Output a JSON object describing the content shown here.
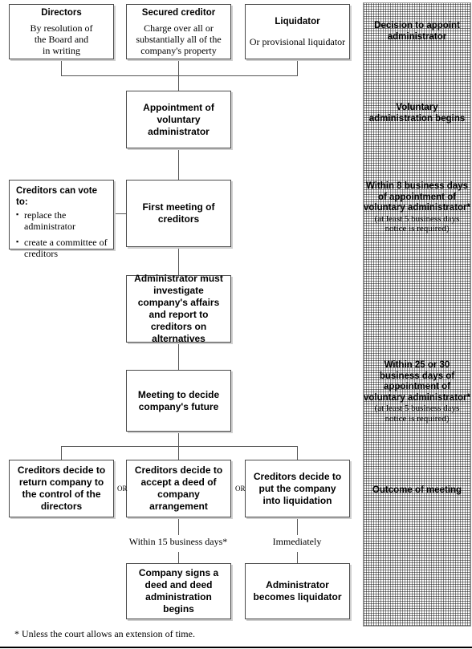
{
  "nodes": {
    "directors": {
      "title": "Directors",
      "body": "By resolution of\nthe Board and\nin writing"
    },
    "secured_creditor": {
      "title": "Secured creditor",
      "body": "Charge over all or\nsubstantially all of the\ncompany's property"
    },
    "liquidator": {
      "title": "Liquidator",
      "body": "Or provisional liquidator"
    },
    "appointment": {
      "title": "Appointment of voluntary administrator"
    },
    "creditors_vote": {
      "heading": "Creditors can vote to:",
      "items": [
        "replace the administrator",
        "create a committee of creditors"
      ]
    },
    "first_meeting": {
      "title": "First meeting of creditors"
    },
    "administrator_investigate": {
      "title": "Administrator must investigate company's affairs and report to creditors on alternatives"
    },
    "meeting_decide": {
      "title": "Meeting to decide company's future"
    },
    "outcome_return": {
      "title": "Creditors decide to return company to the control of the directors"
    },
    "outcome_deed": {
      "title": "Creditors decide to accept a deed of company arrangement"
    },
    "outcome_liquidation": {
      "title": "Creditors decide to put the company into liquidation"
    },
    "deed_signed": {
      "title": "Company signs a deed and deed administration begins"
    },
    "becomes_liquidator": {
      "title": "Administrator becomes liquidator"
    }
  },
  "connector_labels": {
    "or_left": "OR",
    "or_right": "OR",
    "within_15_days": "Within 15 business days*",
    "immediately": "Immediately"
  },
  "sidebar": {
    "stage_1": "Decision to appoint administrator",
    "stage_2": "Voluntary administration begins",
    "stage_3_main": "Within 8 business days of appointment of voluntary administrator*",
    "stage_3_sub": "(at least 5 business days notice is required)",
    "stage_4_main": "Within 25 or 30 business days of appointment of voluntary administrator*",
    "stage_4_sub": "(at least 5 business days notice is required)",
    "stage_5": "Outcome of meeting"
  },
  "footnote": "* Unless the court allows an extension of time."
}
